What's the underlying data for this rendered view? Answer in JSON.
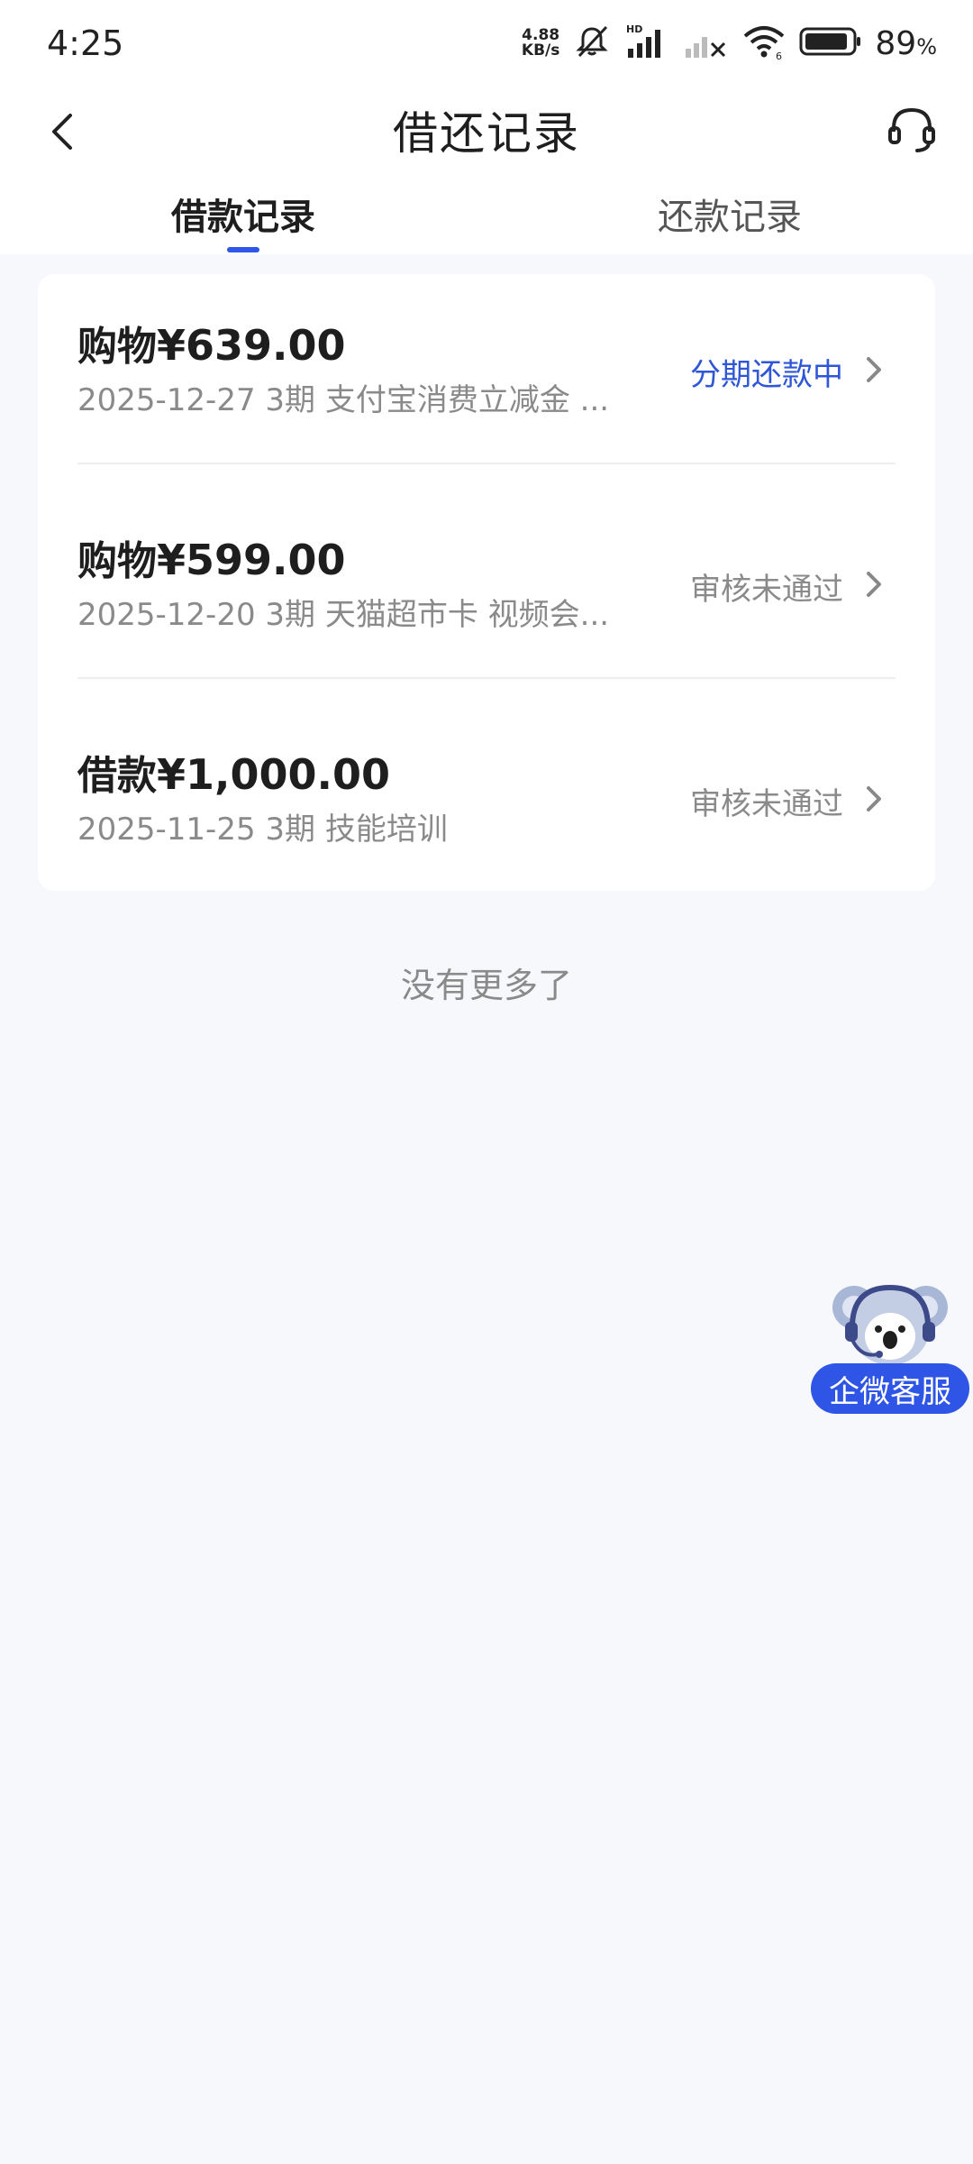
{
  "status_bar": {
    "time": "4:25",
    "net_speed_value": "4.88",
    "net_speed_unit": "KB/s",
    "battery_percent": "89",
    "battery_percent_sign": "%",
    "icons": [
      "mute-icon",
      "signal-hd-icon",
      "signal-icon",
      "wifi-icon",
      "battery-icon"
    ]
  },
  "header": {
    "title": "借还记录",
    "back_icon": "chevron-left-icon",
    "support_icon": "headset-icon"
  },
  "tabs": [
    {
      "label": "借款记录",
      "active": true
    },
    {
      "label": "还款记录",
      "active": false
    }
  ],
  "records": [
    {
      "type": "购物",
      "amount": "¥639.00",
      "meta": "2025-12-27 3期  支付宝消费立减金 ...",
      "status": "分期还款中",
      "status_active": true
    },
    {
      "type": "购物",
      "amount": "¥599.00",
      "meta": "2025-12-20 3期  天猫超市卡 视频会...",
      "status": "审核未通过",
      "status_active": false
    },
    {
      "type": "借款",
      "amount": "¥1,000.00",
      "meta": "2025-11-25 3期  技能培训",
      "status": "审核未通过",
      "status_active": false
    }
  ],
  "footer_text": "没有更多了",
  "float_service": {
    "label": "企微客服",
    "icon": "koala-mascot-icon"
  },
  "colors": {
    "accent": "#2e56e8",
    "background": "#f7f8fc",
    "status_active": "#2e56d6",
    "status_muted": "#8a8a8a"
  }
}
